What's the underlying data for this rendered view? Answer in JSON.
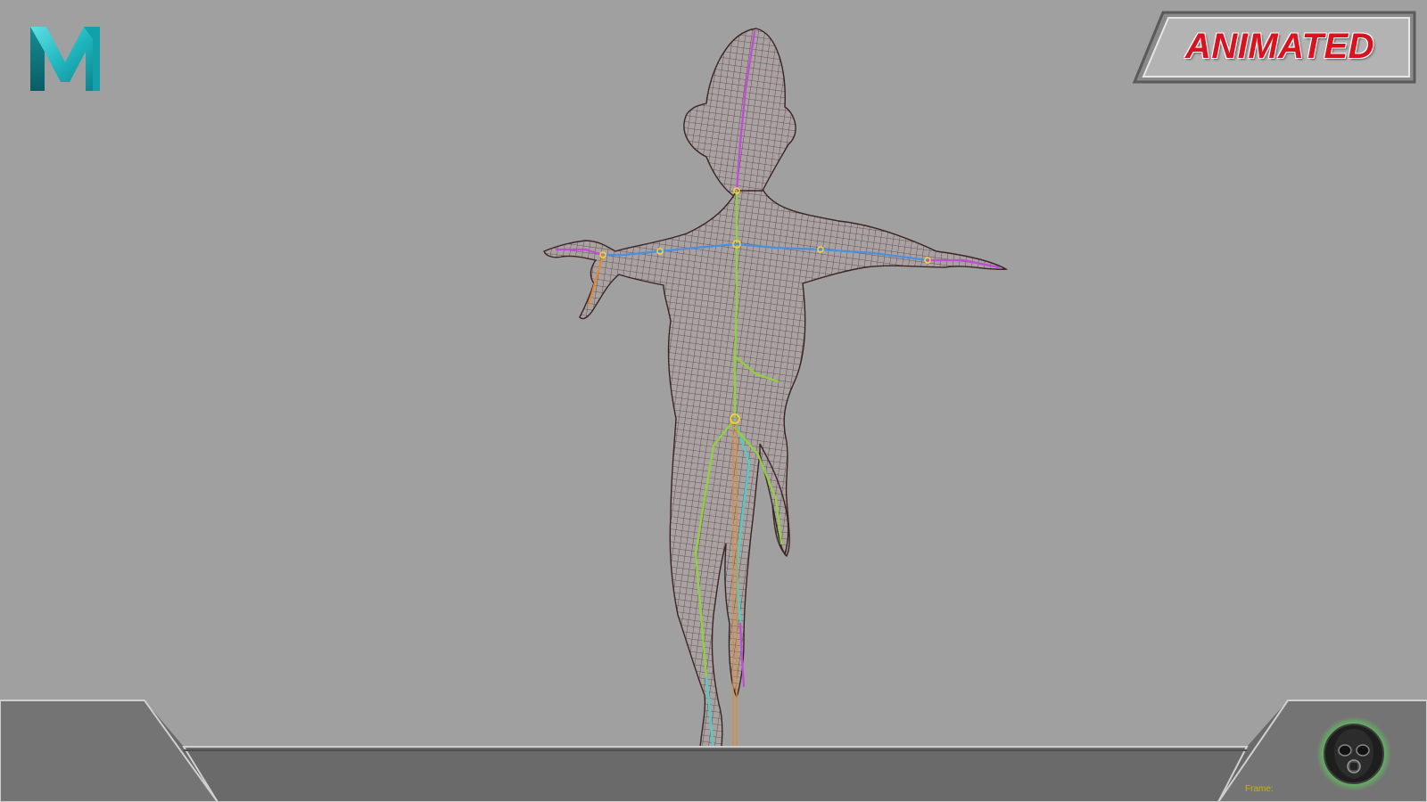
{
  "badge": {
    "label": "ANIMATED"
  },
  "frame": {
    "label": "Frame:"
  },
  "logo": {
    "icon": "maya-logo-icon",
    "color": "#1fb5bd"
  },
  "emblem": {
    "icon": "gas-mask-emblem-icon",
    "glow_color": "#4cff4c"
  },
  "colors": {
    "viewport_background": "#a0a0a0",
    "badge_text": "#d8121e",
    "mesh_wire": "#5a3a3a",
    "bone_blue": "#4b8fe0",
    "bone_green": "#8fd23a",
    "bone_magenta": "#c24ad8",
    "bone_orange": "#e08a30"
  }
}
